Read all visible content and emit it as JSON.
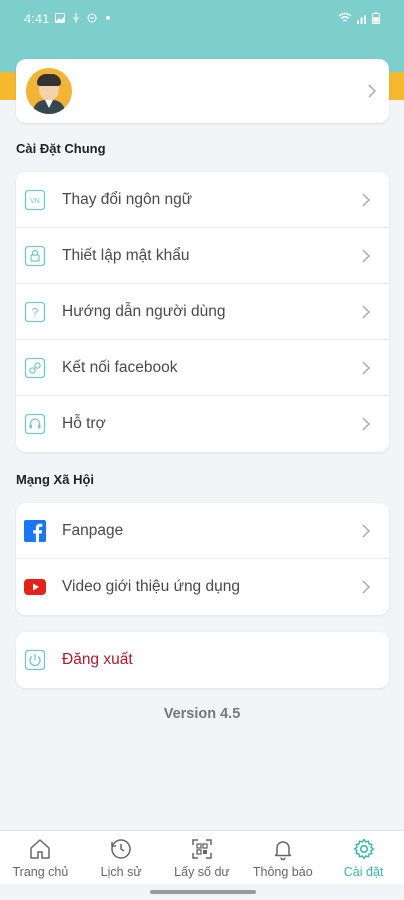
{
  "status_bar": {
    "time": "4:41"
  },
  "profile": {
    "name": ""
  },
  "sections": {
    "general": {
      "title": "Cài Đặt Chung",
      "items": [
        {
          "label": "Thay đổi ngôn ngữ",
          "icon": "language-icon",
          "icon_text": "VN"
        },
        {
          "label": "Thiết lập mật khẩu",
          "icon": "lock-icon"
        },
        {
          "label": "Hướng dẫn người dùng",
          "icon": "help-icon",
          "icon_text": "?"
        },
        {
          "label": "Kết nối facebook",
          "icon": "link-icon"
        },
        {
          "label": "Hỗ trợ",
          "icon": "headset-icon"
        }
      ]
    },
    "social": {
      "title": "Mạng Xã Hội",
      "items": [
        {
          "label": "Fanpage",
          "icon": "facebook-icon",
          "color": "#1877f2"
        },
        {
          "label": "Video giới thiệu ứng dụng",
          "icon": "youtube-icon",
          "color": "#e62117"
        }
      ]
    },
    "logout": {
      "label": "Đăng xuất",
      "icon": "power-icon"
    }
  },
  "version": "Version 4.5",
  "bottom_nav": [
    {
      "label": "Trang chủ",
      "icon": "home-icon"
    },
    {
      "label": "Lịch sử",
      "icon": "history-icon"
    },
    {
      "label": "Lấy số dư",
      "icon": "qr-icon"
    },
    {
      "label": "Thông báo",
      "icon": "bell-icon"
    },
    {
      "label": "Cài đặt",
      "icon": "gear-icon",
      "active": true
    }
  ],
  "colors": {
    "header": "#7dcfcc",
    "accent": "#3bb7ad",
    "wave": "#f5b82e",
    "logout": "#b0182d"
  }
}
